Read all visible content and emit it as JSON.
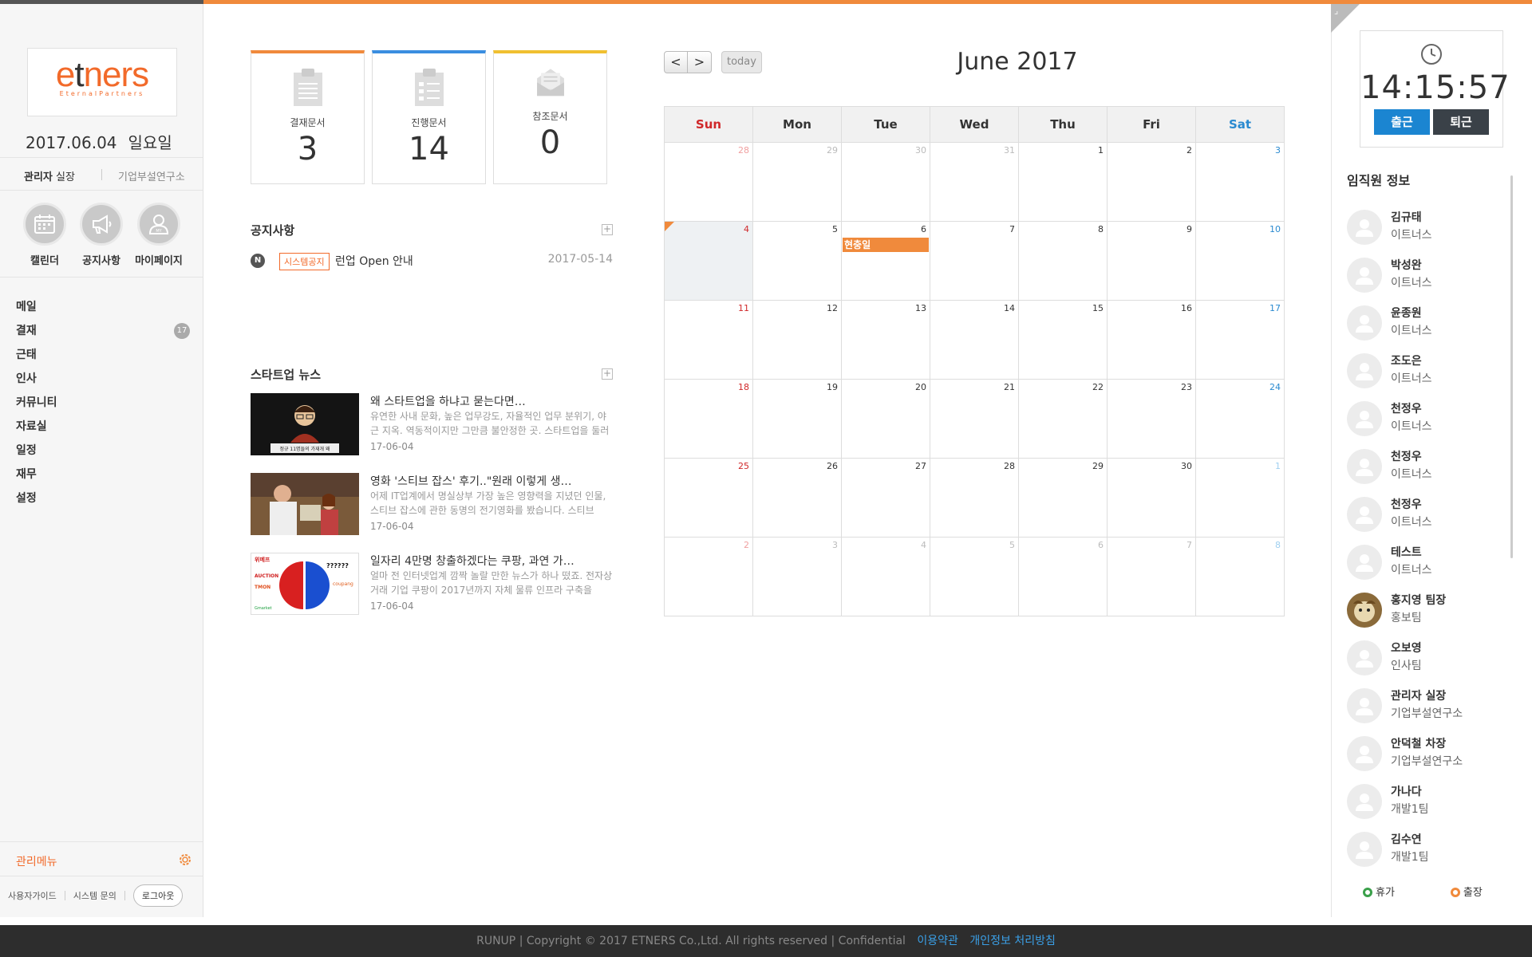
{
  "logo": {
    "text": "etners",
    "tagline": "EternalPartners"
  },
  "sidebar": {
    "date": "2017.06.04",
    "day_of_week": "일요일",
    "user_name": "관리자",
    "user_title": "실장",
    "department": "기업부설연구소",
    "quick": [
      {
        "label": "캘린더",
        "icon": "calendar-icon"
      },
      {
        "label": "공지사항",
        "icon": "megaphone-icon"
      },
      {
        "label": "마이페이지",
        "icon": "user-icon"
      }
    ],
    "menu": [
      {
        "label": "메일"
      },
      {
        "label": "결재",
        "badge": "17"
      },
      {
        "label": "근태"
      },
      {
        "label": "인사"
      },
      {
        "label": "커뮤니티"
      },
      {
        "label": "자료실"
      },
      {
        "label": "일정"
      },
      {
        "label": "재무"
      },
      {
        "label": "설정"
      }
    ],
    "admin_menu": "관리메뉴",
    "footer_links": [
      "사용자가이드",
      "시스템 문의"
    ],
    "logout": "로그아웃"
  },
  "stats": [
    {
      "label": "결재문서",
      "value": "3",
      "color": "#f08a3c",
      "icon": "clipboard-icon"
    },
    {
      "label": "진행문서",
      "value": "14",
      "color": "#3a8ee0",
      "icon": "checklist-icon"
    },
    {
      "label": "참조문서",
      "value": "0",
      "color": "#f0c030",
      "icon": "envelope-icon"
    }
  ],
  "notice": {
    "title": "공지사항",
    "items": [
      {
        "badge": "N",
        "tag": "시스템공지",
        "title": "런업 Open 안내",
        "date": "2017-05-14"
      }
    ]
  },
  "news": {
    "title": "스타트업 뉴스",
    "items": [
      {
        "title": "왜 스타트업을 하냐고 묻는다면…",
        "desc": "유연한 사내 문화, 높은 업무강도, 자율적인 업무 분위기, 야근 지옥. 역동적이지만 그만큼 불안정한 곳. 스타트업을 둘러",
        "date": "17-06-04",
        "thumb_caption": "정규 11명들의 가재개 왜"
      },
      {
        "title": "영화 '스티브 잡스' 후기..\"원래 이렇게 생…",
        "desc": "어제 IT업계에서 명실상부 가장 높은 영향력을 지녔던 인물, 스티브 잡스에 관한 동명의 전기영화를 봤습니다.   스티브",
        "date": "17-06-04"
      },
      {
        "title": "일자리 4만명 창출하겠다는 쿠팡, 과연 가…",
        "desc": "얼마 전 인터넷업계 깜짝 놀랄 만한 뉴스가 하나 떴죠.   전자상거래 기업 쿠팡이 2017년까지 자체 물류 인프라 구축을",
        "date": "17-06-04",
        "thumb_labels": [
          "위메프",
          "AUCTION",
          "TMON",
          "Gmarket",
          "??????",
          "coupang"
        ]
      }
    ]
  },
  "calendar": {
    "prev": "<",
    "next": ">",
    "today_label": "today",
    "title": "June 2017",
    "weekdays": [
      "Sun",
      "Mon",
      "Tue",
      "Wed",
      "Thu",
      "Fri",
      "Sat"
    ],
    "weeks": [
      [
        "28",
        "29",
        "30",
        "31",
        "1",
        "2",
        "3"
      ],
      [
        "4",
        "5",
        "6",
        "7",
        "8",
        "9",
        "10"
      ],
      [
        "11",
        "12",
        "13",
        "14",
        "15",
        "16",
        "17"
      ],
      [
        "18",
        "19",
        "20",
        "21",
        "22",
        "23",
        "24"
      ],
      [
        "25",
        "26",
        "27",
        "28",
        "29",
        "30",
        "1"
      ],
      [
        "2",
        "3",
        "4",
        "5",
        "6",
        "7",
        "8"
      ]
    ],
    "today": "4",
    "events": [
      {
        "date": "6",
        "label": "현충일",
        "color": "#f08a3c"
      }
    ]
  },
  "clock": {
    "time": "14:15:57",
    "check_in": "출근",
    "check_out": "퇴근"
  },
  "employees": {
    "title": "임직원 정보",
    "items": [
      {
        "name": "김규태",
        "dept": "이트너스"
      },
      {
        "name": "박성완",
        "dept": "이트너스"
      },
      {
        "name": "윤종원",
        "dept": "이트너스"
      },
      {
        "name": "조도은",
        "dept": "이트너스"
      },
      {
        "name": "천정우",
        "dept": "이트너스"
      },
      {
        "name": "천정우",
        "dept": "이트너스"
      },
      {
        "name": "천정우",
        "dept": "이트너스"
      },
      {
        "name": "테스트",
        "dept": "이트너스"
      },
      {
        "name": "홍지영 팀장",
        "dept": "홍보팀",
        "photo": true
      },
      {
        "name": "오보영",
        "dept": "인사팀"
      },
      {
        "name": "관리자 실장",
        "dept": "기업부설연구소"
      },
      {
        "name": "안덕철 차장",
        "dept": "기업부설연구소"
      },
      {
        "name": "가나다",
        "dept": "개발1팀"
      },
      {
        "name": "김수연",
        "dept": "개발1팀"
      }
    ],
    "legend": [
      {
        "label": "휴가",
        "color": "#3aa04a"
      },
      {
        "label": "출장",
        "color": "#f08a3c"
      }
    ]
  },
  "footer": {
    "text": "RUNUP | Copyright © 2017 ETNERS Co.,Ltd. All rights reserved | Confidential",
    "links": [
      "이용약관",
      "개인정보 처리방침"
    ]
  },
  "colors": {
    "accent": "#f08a3c",
    "blue": "#1b85d1",
    "dark": "#3a4148"
  }
}
